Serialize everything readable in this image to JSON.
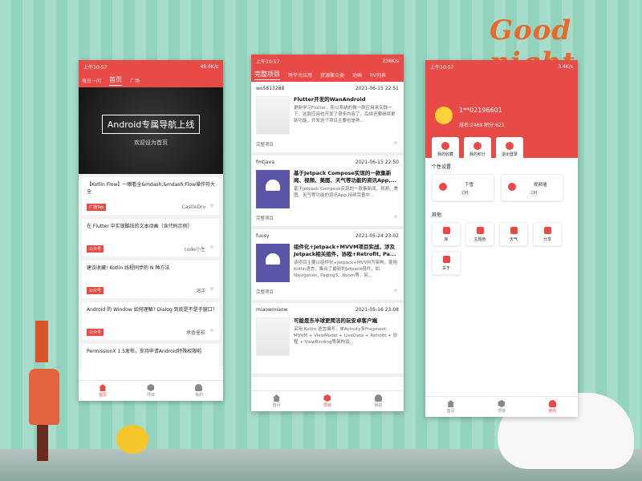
{
  "title_text": "Good night",
  "phone1": {
    "status": {
      "time": "上午10:57",
      "speed": "49.6K/s"
    },
    "tabs": [
      "每日一问",
      "首页",
      "广场"
    ],
    "active_tab": 1,
    "banner": {
      "title": "Android专属导航上线",
      "subtitle": "欢迎设为首页"
    },
    "cards": [
      {
        "title": "【Kotlin Flow】一眼看全&mdash;&mdash;Flow操作符大全",
        "tag": "广场Tab",
        "author": "CastleDrv"
      },
      {
        "title": "在 Flutter 中实现酷炫的文本动画（含代码示例）",
        "tag": "公众号",
        "author": "code小生"
      },
      {
        "title": "建议收藏! Kotlin 线程同步的 N 种方法",
        "tag": "公众号",
        "author": "鸿洋"
      },
      {
        "title": "Android 的 Window 如何理解? Dialog 到底是不是子窗口?",
        "tag": "公众号",
        "author": "承香墨影"
      },
      {
        "title": "PermissionX 1.5发布，支持申请Android特殊权限啦",
        "tag": "",
        "author": ""
      }
    ],
    "nav": [
      "首页",
      "项目",
      "我的"
    ],
    "nav_active": 0
  },
  "phone2": {
    "status": {
      "time": "上午10:57",
      "speed": "236K/s"
    },
    "tabs": [
      "完整项目",
      "跨平台应用",
      "资源聚合类",
      "动画",
      "RV列表"
    ],
    "active_tab": 0,
    "articles": [
      {
        "author": "wo5813288",
        "date": "2021-06-15 22:51",
        "title": "Flutter开发的WanAndroid",
        "desc": "更新学习Flutter，所以系统的做一款应用来实践一下，这款应用也开发了很多内容了，后续还要继续更新功能，开发这个项目主要也是熟...",
        "cat": "完整项目",
        "thumb": "doc"
      },
      {
        "author": "fmtjava",
        "date": "2021-06-15 22:50",
        "title": "基于Jetpack Compose实现的一款集新闻、视频、美图、天气等功能的资讯App,...",
        "desc": "基于Jetpack Compose实现的一款集新闻、视频、美图、天气等功能的资讯App,持续完善中...",
        "cat": "完整项目",
        "thumb": "robot"
      },
      {
        "author": "fuusy",
        "date": "2021-05-24 23:02",
        "title": "组件化+Jetpack+MVVM项目实战，涉及Jetpack相关组件，协程+Retrofit, Pa...",
        "desc": "该项目主要以组件化+Jetpack+MVVM为架构，使用Kotlin语言，集合了最新的Jetpack组件，如Navigation, Paging3、Room等，另...",
        "cat": "完整项目",
        "thumb": "robot"
      },
      {
        "author": "miaowmiaow",
        "date": "2021-05-16 23:08",
        "title": "可能是东半球更简洁的玩安卓客户端",
        "desc": "采用 Kotlin 语言编写，单Activity多Fragment, MVVM + ViewModel + LiveData + Retrofit + 协程 + ViewBinding等架构设...",
        "cat": "",
        "thumb": "doc"
      }
    ],
    "nav": [
      "首页",
      "项目",
      "我的"
    ],
    "nav_active": 1
  },
  "phone3": {
    "status": {
      "time": "上午10:57",
      "speed": "3.4K/s"
    },
    "user": {
      "name": "1**02196601",
      "rank": "排名:2469",
      "points": "积分:621"
    },
    "quick": [
      "我的收藏",
      "我的积分",
      "退出登录"
    ],
    "personal_title": "个性设置",
    "personal": [
      {
        "label": "下雪",
        "toggle": "Off"
      },
      {
        "label": "视频墙",
        "toggle": "Off"
      }
    ],
    "other_title": "其他",
    "other": [
      "库",
      "主题色",
      "天气",
      "分享",
      "关于"
    ],
    "nav": [
      "首页",
      "项目",
      "我的"
    ],
    "nav_active": 2
  }
}
